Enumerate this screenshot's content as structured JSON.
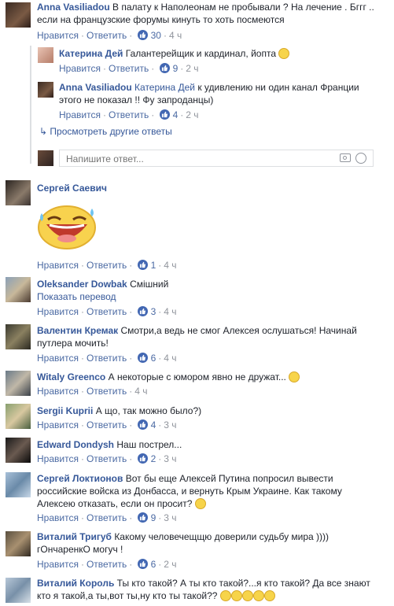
{
  "common": {
    "like": "Нравится",
    "reply": "Ответить",
    "sep": "·"
  },
  "comments": [
    {
      "author": "Anna Vasiliadou",
      "text": "В палату к Наполеонам не пробывали ? На лечение . Бггг .. если на французские форумы кинуть то хоть посмеются",
      "likes": "30",
      "time": "4 ч"
    },
    {
      "author": "Катерина Дей",
      "text": "Галантерейщик и кардинал, йопта",
      "likes": "9",
      "time": "2 ч"
    },
    {
      "author": "Anna Vasiliadou",
      "mention": "Катерина Дей",
      "text": "к удивлению ни один канал Франции этого не показал !! Фу запроданцы)",
      "likes": "4",
      "time": "2 ч"
    },
    {
      "author": "Сергей Саевич",
      "text": "",
      "likes": "1",
      "time": "4 ч"
    },
    {
      "author": "Oleksander Dowbak",
      "text": "Смішний",
      "translate": "Показать перевод",
      "likes": "3",
      "time": "4 ч"
    },
    {
      "author": "Валентин Кремак",
      "text": "Смотри,а ведь не смог Алексея ослушаться! Начинай путлера мочить!",
      "likes": "6",
      "time": "4 ч"
    },
    {
      "author": "Witaly Greenco",
      "text": "А некоторые с юмором явно не дружат...",
      "likes": "",
      "time": "4 ч"
    },
    {
      "author": "Sergii Kuprii",
      "text": "А що, так можно было?)",
      "likes": "4",
      "time": "3 ч"
    },
    {
      "author": "Edward Dondysh",
      "text": "Наш пострел...",
      "likes": "2",
      "time": "3 ч"
    },
    {
      "author": "Сергей Локтионов",
      "text": "Вот бы еще Алексей Путина попросил вывести российские войска из Донбасса, и вернуть Крым Украине. Как такому Алексею отказать, если он просит?",
      "likes": "9",
      "time": "3 ч"
    },
    {
      "author": "Виталий Тригуб",
      "text": "Какому человечещщю доверили судьбу мира )))) гОнчаренкО могуч !",
      "likes": "6",
      "time": "2 ч"
    },
    {
      "author": "Виталий Король",
      "text": "Ты кто такой? А ты кто такой?...я кто такой? Да все знают кто я такой,а ты,вот ты,ну кто ты такой??"
    }
  ],
  "more_replies": "Просмотреть другие ответы",
  "reply_input": {
    "placeholder": "Напишите ответ..."
  },
  "colors": {
    "link": "#365899",
    "meta": "#90949c",
    "like_badge": "#4267b2"
  }
}
